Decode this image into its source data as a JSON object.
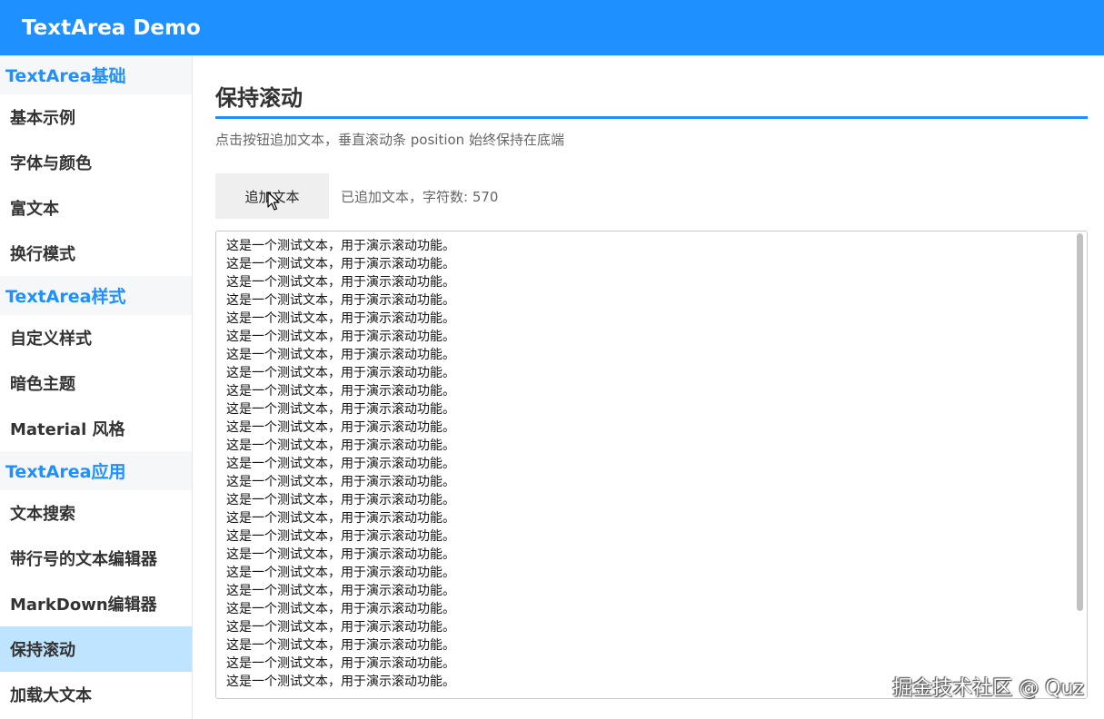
{
  "header": {
    "title": "TextArea Demo"
  },
  "sidebar": {
    "groups": [
      {
        "title": "TextArea基础",
        "items": [
          "基本示例",
          "字体与颜色",
          "富文本",
          "换行模式"
        ]
      },
      {
        "title": "TextArea样式",
        "items": [
          "自定义样式",
          "暗色主题",
          "Material 风格"
        ]
      },
      {
        "title": "TextArea应用",
        "items": [
          "文本搜索",
          "带行号的文本编辑器",
          "MarkDown编辑器",
          "保持滚动",
          "加载大文本"
        ]
      }
    ],
    "active_item": "保持滚动"
  },
  "main": {
    "title": "保持滚动",
    "description": "点击按钮追加文本，垂直滚动条 position 始终保持在底端",
    "append_button_label": "追加文本",
    "status": "已追加文本，字符数: 570",
    "textarea": {
      "lines": [
        "这是一个测试文本，用于演示滚动功能。",
        "这是一个测试文本，用于演示滚动功能。",
        "这是一个测试文本，用于演示滚动功能。",
        "这是一个测试文本，用于演示滚动功能。",
        "这是一个测试文本，用于演示滚动功能。",
        "这是一个测试文本，用于演示滚动功能。",
        "这是一个测试文本，用于演示滚动功能。",
        "这是一个测试文本，用于演示滚动功能。",
        "这是一个测试文本，用于演示滚动功能。",
        "这是一个测试文本，用于演示滚动功能。",
        "这是一个测试文本，用于演示滚动功能。",
        "这是一个测试文本，用于演示滚动功能。",
        "这是一个测试文本，用于演示滚动功能。",
        "这是一个测试文本，用于演示滚动功能。",
        "这是一个测试文本，用于演示滚动功能。",
        "这是一个测试文本，用于演示滚动功能。",
        "这是一个测试文本，用于演示滚动功能。",
        "这是一个测试文本，用于演示滚动功能。",
        "这是一个测试文本，用于演示滚动功能。",
        "这是一个测试文本，用于演示滚动功能。",
        "这是一个测试文本，用于演示滚动功能。",
        "这是一个测试文本，用于演示滚动功能。",
        "这是一个测试文本，用于演示滚动功能。",
        "这是一个测试文本，用于演示滚动功能。",
        "这是一个测试文本，用于演示滚动功能。"
      ],
      "scroll_position": "bottom"
    }
  },
  "watermark": "掘金技术社区 @ Quz",
  "colors": {
    "accent": "#1e90ff",
    "active_nav": "#bfe4ff",
    "group_bg": "#f6f7f9"
  },
  "icons": {
    "cursor": "mouse-pointer-icon"
  }
}
